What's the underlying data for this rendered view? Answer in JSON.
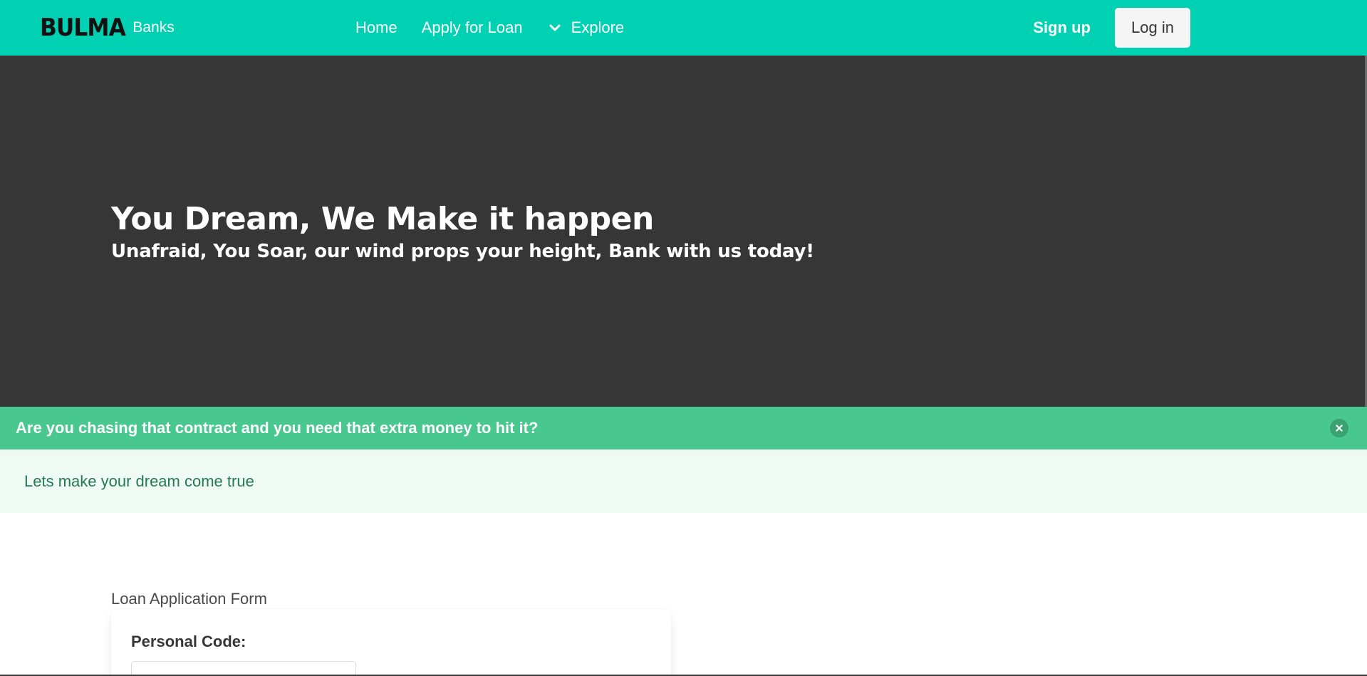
{
  "navbar": {
    "brand_logo": "BULMA",
    "brand_sub": "Banks",
    "items": [
      {
        "label": "Home"
      },
      {
        "label": "Apply for Loan"
      },
      {
        "label": "Explore",
        "icon": "chevron-down-icon"
      }
    ],
    "signup_label": "Sign up",
    "login_label": "Log in",
    "color": "#00d1b2"
  },
  "hero": {
    "title": "You Dream, We Make it happen",
    "subtitle": "Unafraid, You Soar, our wind props your height, Bank with us today!",
    "background": "#363636"
  },
  "message": {
    "title": "Are you chasing that contract and you need that extra money to hit it?",
    "body": "Lets make your dream come true",
    "header_color": "#48c78e",
    "body_color": "#effaf5"
  },
  "form": {
    "caption": "Loan Application Form",
    "fields": [
      {
        "label": "Personal Code:",
        "value": "",
        "placeholder": ""
      }
    ]
  }
}
